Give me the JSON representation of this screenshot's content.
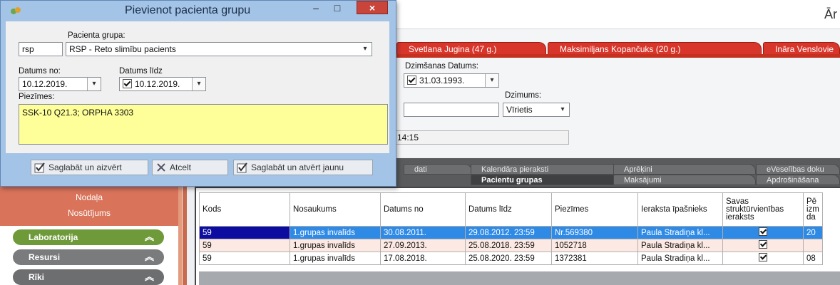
{
  "dialog": {
    "title": "Pievienot pacienta grupu",
    "close_label": "×",
    "minimize_label": "–",
    "maximize_label": "□",
    "group_label": "Pacienta grupa:",
    "group_code": "rsp",
    "group_value": "RSP - Reto slimību pacients",
    "date_from_label": "Datums no:",
    "date_from_value": "10.12.2019.",
    "date_to_label": "Datums līdz",
    "date_to_value": "10.12.2019.",
    "notes_label": "Piezīmes:",
    "notes_value": "SSK-10 Q21.3; ORPHA 3303",
    "btn_save_close": "Saglabāt un aizvērt",
    "btn_cancel": "Atcelt",
    "btn_save_new": "Saglabāt un atvērt jaunu"
  },
  "app": {
    "title_fragment": "Ār",
    "patient_tabs": [
      "Svetlana Jugina (47 g.)",
      "Maksimiljans Kopančuks (20 g.)",
      "Ināra Venslovie"
    ],
    "birth_label": "Dzimšanas Datums:",
    "birth_value": "31.03.1993.",
    "gender_label": "Dzimums:",
    "gender_value": "Vīrietis",
    "time_value": "14:15",
    "tabs_row1": [
      "dati",
      "Kalendāra pieraksti",
      "Aprēķini",
      "eVeselības doku"
    ],
    "tabs_row2": [
      "Pacientu grupas",
      "Maksājumi",
      "Apdrošināšana"
    ]
  },
  "sidebar": {
    "links": [
      "Nodaļa",
      "Nosūtījums"
    ],
    "sections": [
      {
        "label": "Laboratorija",
        "color": "#6f9a3a"
      },
      {
        "label": "Resursi",
        "color": "#7a7b7d"
      },
      {
        "label": "Rīki",
        "color": "#6d6e70"
      }
    ]
  },
  "grid": {
    "headers": [
      "Kods",
      "Nosaukums",
      "Datums no",
      "Datums līdz",
      "Piezīmes",
      "Ieraksta īpašnieks",
      "Savas struktūrvienības ieraksts",
      "Pē izm da"
    ],
    "rows": [
      {
        "kods": "59",
        "nosaukums": "1.grupas invalīds",
        "no": "30.08.2011.",
        "lidz": "29.08.2012. 23:59",
        "piezimes": "Nr.569380",
        "ipasnieks": "Paula Stradiņa kl...",
        "extra": "20"
      },
      {
        "kods": "59",
        "nosaukums": "1.grupas invalīds",
        "no": "27.09.2013.",
        "lidz": "25.08.2018. 23:59",
        "piezimes": "1052718",
        "ipasnieks": "Paula Stradiņa kl...",
        "extra": ""
      },
      {
        "kods": "59",
        "nosaukums": "1.grupas invalīds",
        "no": "17.08.2018.",
        "lidz": "25.08.2020. 23:59",
        "piezimes": "1372381",
        "ipasnieks": "Paula Stradiņa kl...",
        "extra": "08"
      }
    ]
  },
  "colors": {
    "dialog_bg": "#a3c4e6",
    "tab_red": "#d9362b",
    "selected_row": "#2f8ae6",
    "notes_bg": "#ffff99"
  }
}
